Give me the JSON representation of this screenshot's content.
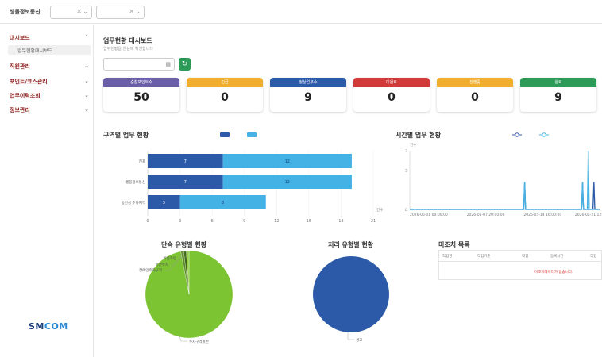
{
  "topbar": {
    "title": "셍물정보통신",
    "selects": [
      {
        "value": "",
        "clear": "✕",
        "chevron": "⌄"
      },
      {
        "value": "",
        "clear": "✕",
        "chevron": "⌄"
      }
    ]
  },
  "sidebar": {
    "items": [
      {
        "label": "대시보드",
        "chevron": "⌃"
      },
      {
        "label": "직원관리",
        "chevron": "⌄"
      },
      {
        "label": "포인트/코스관리",
        "chevron": "⌄"
      },
      {
        "label": "업무이력조회",
        "chevron": "⌄"
      },
      {
        "label": "정보관리",
        "chevron": "⌄"
      }
    ],
    "submenu": "업무현황대시보드",
    "logo_main": "SM",
    "logo_accent": "COM"
  },
  "main": {
    "title": "업무현황 대시보드",
    "subtitle": "업무현황을 한눈에 확인합니다",
    "date_value": "",
    "refresh_icon": "↻"
  },
  "cards": [
    {
      "label": "순찰포인트수",
      "value": "50",
      "color": "#6b5ea8"
    },
    {
      "label": "긴급",
      "value": "0",
      "color": "#f0ad2e"
    },
    {
      "label": "정상업무수",
      "value": "9",
      "color": "#2a5aa8"
    },
    {
      "label": "미완료",
      "value": "0",
      "color": "#d23a3a"
    },
    {
      "label": "진행중",
      "value": "0",
      "color": "#f0ad2e"
    },
    {
      "label": "완료",
      "value": "9",
      "color": "#2e9a57"
    }
  ],
  "colors": {
    "dark_blue": "#2c5aa8",
    "light_blue": "#44b2e5",
    "green": "#7cc432",
    "line_dark": "#2c5aa8",
    "line_light": "#44b2e5"
  },
  "sections": {
    "area_chart_title": "구역별 업무 현황",
    "time_chart_title": "시간별 업무 현황",
    "violation_title": "단속 유형별 현황",
    "process_title": "처리 유형별 현황",
    "unresolved_title": "미조치 목록"
  },
  "chart_data": [
    {
      "type": "bar",
      "title": "구역별 업무 현황",
      "orientation": "horizontal",
      "stacked": true,
      "categories": [
        "전포",
        "셍물정보통신",
        "동인성 주차지역"
      ],
      "series": [
        {
          "values": [
            7,
            7,
            3
          ],
          "labels": [
            "7",
            "7",
            "3"
          ]
        },
        {
          "values": [
            12,
            12,
            8
          ],
          "labels": [
            "12",
            "12",
            "8"
          ]
        }
      ],
      "xticks": [
        "0",
        "3",
        "6",
        "9",
        "12",
        "15",
        "18",
        "21"
      ],
      "xlim": [
        0,
        21
      ],
      "x_unit": "건수",
      "legend": "top"
    },
    {
      "type": "line",
      "title": "시간별 업무 현황",
      "y_unit": "건수",
      "ylim": [
        0,
        3
      ],
      "yticks": [
        "0",
        "2",
        "3"
      ],
      "xticks": [
        "2026-05-01 00:00:00",
        "2026-05-07 20:00:00",
        "2026-05-14 16:00:00",
        "2026-05-21 12:00:00"
      ],
      "series": [
        {
          "points": [
            [
              0.0,
              0
            ],
            [
              0.6,
              0
            ],
            [
              0.605,
              1.4
            ],
            [
              0.61,
              0
            ],
            [
              0.905,
              0
            ],
            [
              0.91,
              1.4
            ],
            [
              0.915,
              0
            ],
            [
              0.935,
              0
            ],
            [
              0.94,
              3
            ],
            [
              0.945,
              0
            ],
            [
              1.0,
              0
            ]
          ]
        },
        {
          "points": [
            [
              0.0,
              0
            ],
            [
              0.6,
              0
            ],
            [
              0.605,
              1.4
            ],
            [
              0.61,
              0
            ],
            [
              0.905,
              0
            ],
            [
              0.91,
              1.4
            ],
            [
              0.915,
              0
            ],
            [
              0.965,
              0
            ],
            [
              0.97,
              1.4
            ],
            [
              0.975,
              0
            ],
            [
              1.0,
              0
            ]
          ]
        }
      ],
      "legend": "top"
    },
    {
      "type": "pie",
      "title": "단속 유형별 현황",
      "slices": [
        {
          "label": "주차구역위반",
          "value": 97
        },
        {
          "label": "비번차량",
          "value": 1
        },
        {
          "label": "이면주차",
          "value": 1
        },
        {
          "label": "장애인주차구역",
          "value": 1
        }
      ]
    },
    {
      "type": "pie",
      "title": "처리 유형별 현황",
      "slices": [
        {
          "label": "경고",
          "value": 100
        }
      ]
    }
  ],
  "unresolved_table": {
    "columns": [
      "작업명",
      "작업기준",
      "작업",
      "등록시간",
      "작업"
    ],
    "empty_message": "미조치데이터가 없습니다."
  }
}
